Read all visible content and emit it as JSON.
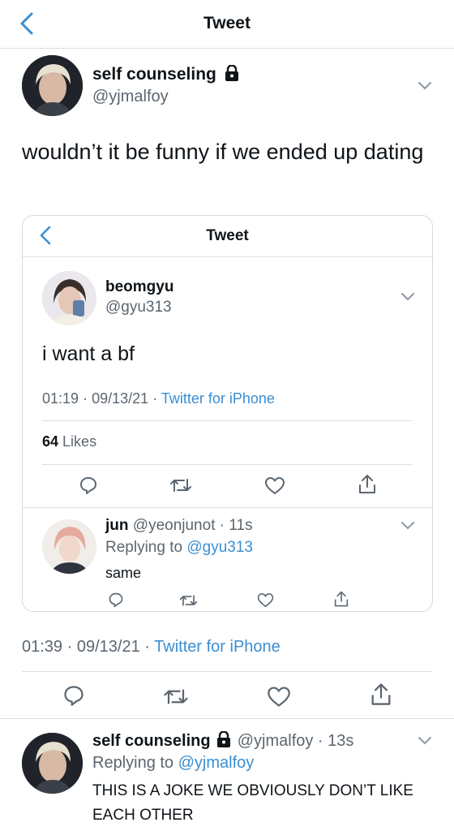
{
  "header": {
    "title": "Tweet"
  },
  "main_tweet": {
    "display_name": "self counseling",
    "handle": "@yjmalfoy",
    "text": "wouldn’t it be funny if we ended up dating",
    "time": "01:39",
    "date": "09/13/21",
    "source": "Twitter for iPhone",
    "meta_sep": "·"
  },
  "quoted": {
    "header_title": "Tweet",
    "display_name": "beomgyu",
    "handle": "@gyu313",
    "text": "i want a bf",
    "time": "01:19",
    "date": "09/13/21",
    "source": "Twitter for iPhone",
    "meta_sep": "·",
    "likes_count": "64",
    "likes_label": "Likes",
    "reply": {
      "display_name": "jun",
      "handle": "@yeonjunot",
      "age": "11s",
      "replying_to_label": "Replying to",
      "replying_to": "@gyu313",
      "text": "same"
    }
  },
  "bottom_reply": {
    "display_name": "self counseling",
    "handle": "@yjmalfoy",
    "age": "13s",
    "replying_to_label": "Replying to",
    "replying_to": "@yjmalfoy",
    "text": "THIS IS A JOKE WE OBVIOUSLY DON’T LIKE EACH OTHER"
  },
  "colors": {
    "accent": "#3a8ed1",
    "muted": "#5b6670",
    "divider": "#dcdfe3"
  }
}
